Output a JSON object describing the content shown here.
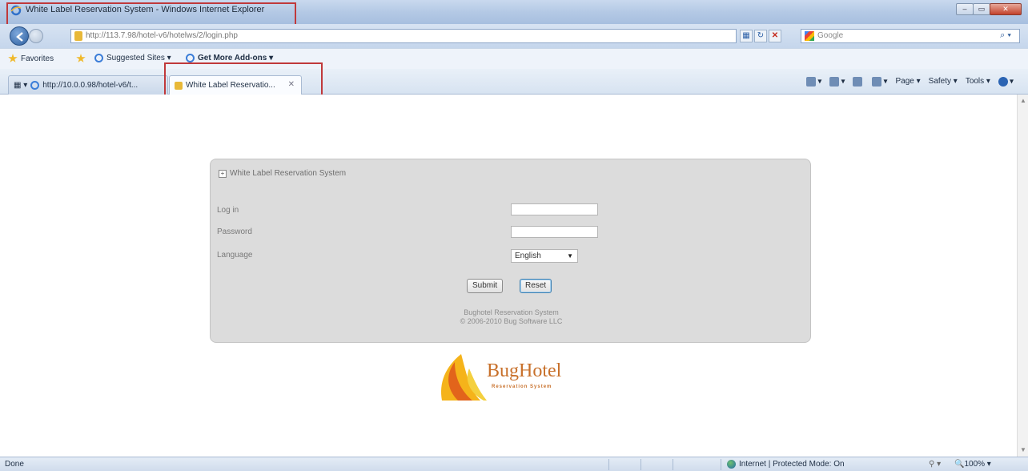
{
  "window": {
    "title": "White Label Reservation System - Windows Internet Explorer"
  },
  "address_bar": {
    "url": "http://113.7.98/hotel-v6/hotelws/2/login.php",
    "search_provider": "Google"
  },
  "favorites_bar": {
    "favorites_label": "Favorites",
    "suggested_sites_label": "Suggested Sites ▾",
    "addons_label": "Get More Add-ons ▾"
  },
  "tabs": [
    {
      "label": "http://10.0.0.98/hotel-v6/t..."
    },
    {
      "label": "White Label Reservatio..."
    }
  ],
  "command_bar": {
    "page_label": "Page ▾",
    "safety_label": "Safety ▾",
    "tools_label": "Tools ▾"
  },
  "login_panel": {
    "header": "White Label Reservation System",
    "login_label": "Log in",
    "password_label": "Password",
    "language_label": "Language",
    "language_value": "English",
    "submit_label": "Submit",
    "reset_label": "Reset",
    "footer_line1": "Bughotel Reservation System",
    "footer_line2": "© 2006-2010 Bug Software LLC"
  },
  "logo": {
    "brand": "BugHotel",
    "tagline": "Reservation System"
  },
  "status_bar": {
    "status_text": "Done",
    "zone_text": "Internet | Protected Mode: On",
    "zoom_text": "100%"
  },
  "colors": {
    "accent_red_highlight": "#c0393b",
    "logo_orange": "#c8702a",
    "panel_bg": "#dcdcdc"
  }
}
